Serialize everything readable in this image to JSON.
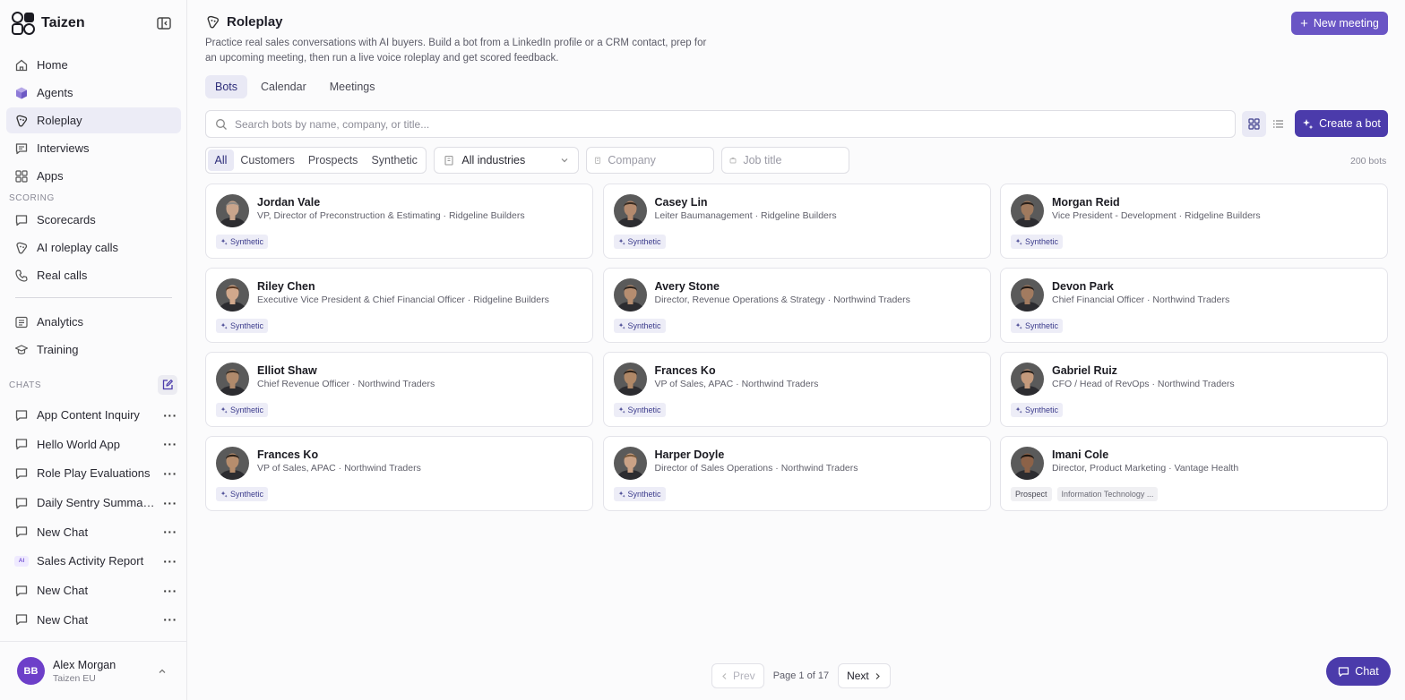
{
  "app": {
    "name": "Taizen"
  },
  "sidebar": {
    "nav_primary": [
      {
        "label": "Home",
        "icon": "home-icon",
        "active": false
      },
      {
        "label": "Agents",
        "icon": "cube-icon",
        "active": false
      },
      {
        "label": "Roleplay",
        "icon": "roleplay-icon",
        "active": true
      },
      {
        "label": "Interviews",
        "icon": "message-icon",
        "active": false
      },
      {
        "label": "Apps",
        "icon": "apps-grid-icon",
        "active": false
      }
    ],
    "scoring_label": "SCORING",
    "nav_scoring": [
      {
        "label": "Scorecards",
        "icon": "scorecard-icon"
      },
      {
        "label": "AI roleplay calls",
        "icon": "roleplay-icon"
      },
      {
        "label": "Real calls",
        "icon": "phone-icon"
      }
    ],
    "nav_secondary": [
      {
        "label": "Analytics",
        "icon": "list-icon"
      },
      {
        "label": "Training",
        "icon": "graduation-cap-icon"
      }
    ],
    "chats_label": "CHATS",
    "chats": [
      {
        "label": "App Content Inquiry",
        "icon": "message-icon"
      },
      {
        "label": "Hello World App",
        "icon": "message-icon"
      },
      {
        "label": "Role Play Evaluations",
        "icon": "message-icon"
      },
      {
        "label": "Daily Sentry Summar...",
        "icon": "message-icon"
      },
      {
        "label": "New Chat",
        "icon": "message-icon"
      },
      {
        "label": "Sales Activity Report",
        "icon": "ai-badge",
        "badge": "AI"
      },
      {
        "label": "New Chat",
        "icon": "message-icon"
      },
      {
        "label": "New Chat",
        "icon": "message-icon"
      }
    ],
    "user": {
      "initials": "BB",
      "name": "Alex Morgan",
      "org": "Taizen EU"
    }
  },
  "header": {
    "title": "Roleplay",
    "description": "Practice real sales conversations with AI buyers. Build a bot from a LinkedIn profile or a CRM contact, prep for an upcoming meeting, then run a live voice roleplay and get scored feedback.",
    "new_meeting_label": "New meeting"
  },
  "tabs": [
    {
      "label": "Bots",
      "active": true
    },
    {
      "label": "Calendar",
      "active": false
    },
    {
      "label": "Meetings",
      "active": false
    }
  ],
  "search": {
    "placeholder": "Search bots by name, company, or title..."
  },
  "create_bot_label": "Create a bot",
  "filters": {
    "segments": [
      {
        "label": "All",
        "active": true
      },
      {
        "label": "Customers",
        "active": false
      },
      {
        "label": "Prospects",
        "active": false
      },
      {
        "label": "Synthetic",
        "active": false
      }
    ],
    "industry_value": "All industries",
    "company_placeholder": "Company",
    "job_title_placeholder": "Job title"
  },
  "bot_count": "200 bots",
  "bots": [
    {
      "name": "Jordan Vale",
      "title": "VP, Director of Preconstruction & Estimating · Ridgeline Builders",
      "tags": [
        "Synthetic"
      ],
      "skin": "#c9a58c",
      "hair": "#8e8a85"
    },
    {
      "name": "Casey Lin",
      "title": "Leiter Baumanagement · Ridgeline Builders",
      "tags": [
        "Synthetic"
      ],
      "skin": "#b48a6e",
      "hair": "#3a2c22"
    },
    {
      "name": "Morgan Reid",
      "title": "Vice President - Development · Ridgeline Builders",
      "tags": [
        "Synthetic"
      ],
      "skin": "#a07a5e",
      "hair": "#2a211c"
    },
    {
      "name": "Riley Chen",
      "title": "Executive Vice President & Chief Financial Officer · Ridgeline Builders",
      "tags": [
        "Synthetic"
      ],
      "skin": "#d1a88c",
      "hair": "#5a3a26"
    },
    {
      "name": "Avery Stone",
      "title": "Director, Revenue Operations & Strategy · Northwind Traders",
      "tags": [
        "Synthetic"
      ],
      "skin": "#b58d70",
      "hair": "#2f2620"
    },
    {
      "name": "Devon Park",
      "title": "Chief Financial Officer · Northwind Traders",
      "tags": [
        "Synthetic"
      ],
      "skin": "#a27b60",
      "hair": "#231b17"
    },
    {
      "name": "Elliot Shaw",
      "title": "Chief Revenue Officer · Northwind Traders",
      "tags": [
        "Synthetic"
      ],
      "skin": "#b08a6c",
      "hair": "#3a3028"
    },
    {
      "name": "Frances Ko",
      "title": "VP of Sales, APAC · Northwind Traders",
      "tags": [
        "Synthetic"
      ],
      "skin": "#b08867",
      "hair": "#2e231b"
    },
    {
      "name": "Gabriel Ruiz",
      "title": "CFO / Head of RevOps · Northwind Traders",
      "tags": [
        "Synthetic"
      ],
      "skin": "#c49a7c",
      "hair": "#1f1a18"
    },
    {
      "name": "Frances Ko",
      "title": "VP of Sales, APAC · Northwind Traders",
      "tags": [
        "Synthetic"
      ],
      "skin": "#b68d6d",
      "hair": "#2c221a"
    },
    {
      "name": "Harper Doyle",
      "title": "Director of Sales Operations · Northwind Traders",
      "tags": [
        "Synthetic"
      ],
      "skin": "#caa286",
      "hair": "#7a5a3c"
    },
    {
      "name": "Imani Cole",
      "title": "Director, Product Marketing · Vantage Health",
      "tags": [
        "Prospect",
        "Information Technology ..."
      ],
      "skin": "#8c6248",
      "hair": "#1e1712"
    }
  ],
  "pagination": {
    "prev_label": "Prev",
    "page_info": "Page 1 of 17",
    "next_label": "Next"
  },
  "chat_fab_label": "Chat",
  "colors": {
    "accent": "#4b3bab",
    "accent_light": "#6a55c5",
    "active_bg": "#e9e9f5"
  }
}
